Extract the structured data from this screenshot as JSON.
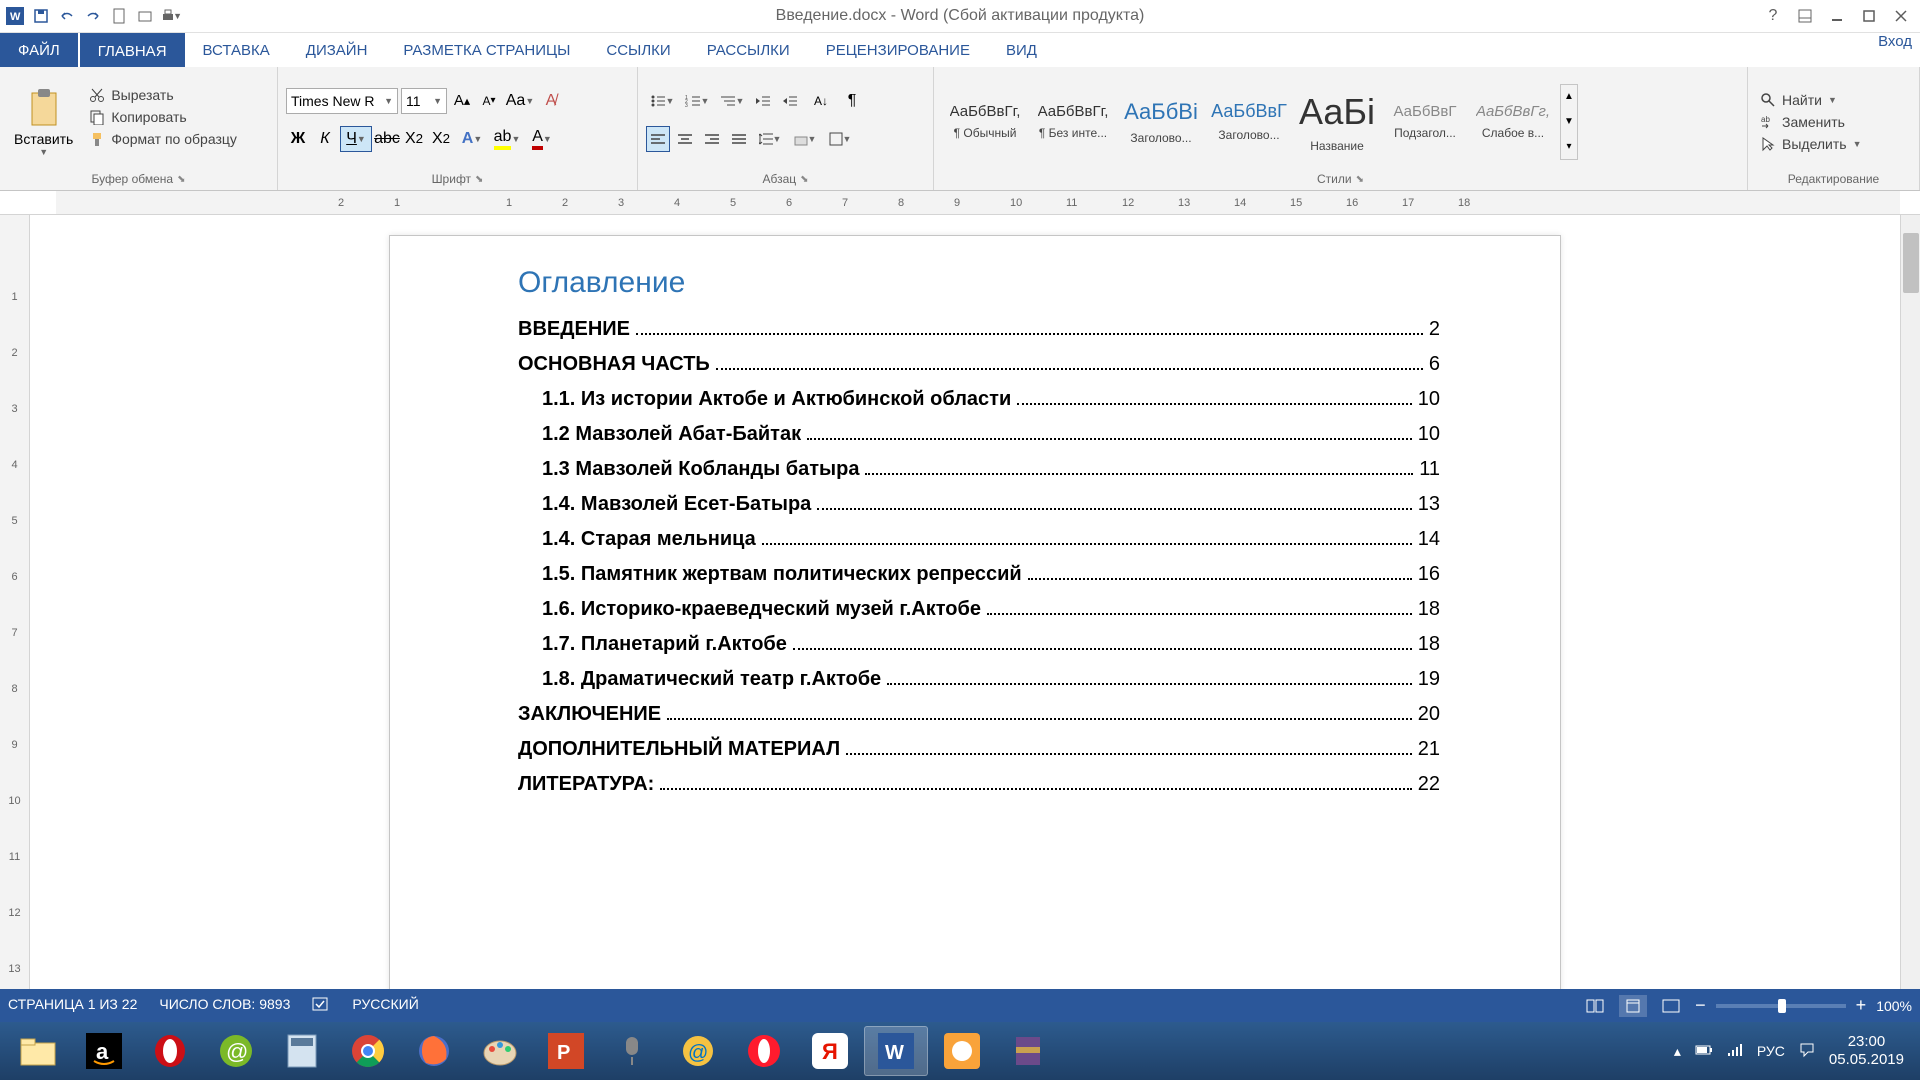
{
  "title": "Введение.docx - Word (Сбой активации продукта)",
  "tabs": {
    "file": "ФАЙЛ",
    "home": "ГЛАВНАЯ",
    "insert": "ВСТАВКА",
    "design": "ДИЗАЙН",
    "layout": "РАЗМЕТКА СТРАНИЦЫ",
    "references": "ССЫЛКИ",
    "mailings": "РАССЫЛКИ",
    "review": "РЕЦЕНЗИРОВАНИЕ",
    "view": "ВИД",
    "login": "Вход"
  },
  "clipboard": {
    "paste": "Вставить",
    "cut": "Вырезать",
    "copy": "Копировать",
    "format_painter": "Формат по образцу",
    "group": "Буфер обмена"
  },
  "font": {
    "name": "Times New R",
    "size": "11",
    "group": "Шрифт"
  },
  "paragraph": {
    "group": "Абзац"
  },
  "styles": {
    "group": "Стили",
    "items": [
      {
        "preview": "АаБбВвГг,",
        "name": "¶ Обычный",
        "cls": ""
      },
      {
        "preview": "АаБбВвГг,",
        "name": "¶ Без инте...",
        "cls": ""
      },
      {
        "preview": "АаБбВі",
        "name": "Заголово...",
        "cls": "c2e74b5 s22"
      },
      {
        "preview": "АаБбВвГ",
        "name": "Заголово...",
        "cls": "c2e74b5 s18"
      },
      {
        "preview": "АаБі",
        "name": "Название",
        "cls": "s36"
      },
      {
        "preview": "АаБбВвГ",
        "name": "Подзагол...",
        "cls": "c888"
      },
      {
        "preview": "АаБбВвГг,",
        "name": "Слабое в...",
        "cls": "ital c888"
      }
    ]
  },
  "editing": {
    "find": "Найти",
    "replace": "Заменить",
    "select": "Выделить",
    "group": "Редактирование"
  },
  "document": {
    "toc_title": "Оглавление",
    "entries": [
      {
        "text": "ВВЕДЕНИЕ",
        "page": "2",
        "sub": false
      },
      {
        "text": "ОСНОВНАЯ ЧАСТЬ",
        "page": "6",
        "sub": false
      },
      {
        "text": "1.1. Из истории Актобе и Актюбинской области",
        "page": "10",
        "sub": true
      },
      {
        "text": "1.2 Мавзолей Абат-Байтак",
        "page": "10",
        "sub": true
      },
      {
        "text": "1.3 Мавзолей Кобланды батыра",
        "page": "11",
        "sub": true
      },
      {
        "text": "1.4. Мавзолей Есет-Батыра",
        "page": "13",
        "sub": true
      },
      {
        "text": "1.4. Старая мельница",
        "page": "14",
        "sub": true
      },
      {
        "text": "1.5. Памятник жертвам политических репрессий",
        "page": "16",
        "sub": true
      },
      {
        "text": "1.6. Историко-краеведческий музей г.Актобе",
        "page": "18",
        "sub": true
      },
      {
        "text": "1.7. Планетарий г.Актобе",
        "page": "18",
        "sub": true
      },
      {
        "text": "1.8. Драматический театр г.Актобе",
        "page": "19",
        "sub": true
      },
      {
        "text": "ЗАКЛЮЧЕНИЕ",
        "page": "20",
        "sub": false
      },
      {
        "text": "ДОПОЛНИТЕЛЬНЫЙ МАТЕРИАЛ",
        "page": "21",
        "sub": false
      },
      {
        "text": "ЛИТЕРАТУРА:",
        "page": "22",
        "sub": false
      }
    ]
  },
  "statusbar": {
    "page": "СТРАНИЦА 1 ИЗ 22",
    "words": "ЧИСЛО СЛОВ: 9893",
    "lang": "РУССКИЙ",
    "zoom": "100%"
  },
  "tray": {
    "keyboard": "РУС",
    "time": "23:00",
    "date": "05.05.2019"
  },
  "ruler_h": [
    "2",
    "1",
    "",
    "1",
    "2",
    "3",
    "4",
    "5",
    "6",
    "7",
    "8",
    "9",
    "10",
    "11",
    "12",
    "13",
    "14",
    "15",
    "16",
    "17",
    "18"
  ],
  "ruler_v": [
    "",
    "1",
    "2",
    "3",
    "4",
    "5",
    "6",
    "7",
    "8",
    "9",
    "10",
    "11",
    "12",
    "13"
  ]
}
